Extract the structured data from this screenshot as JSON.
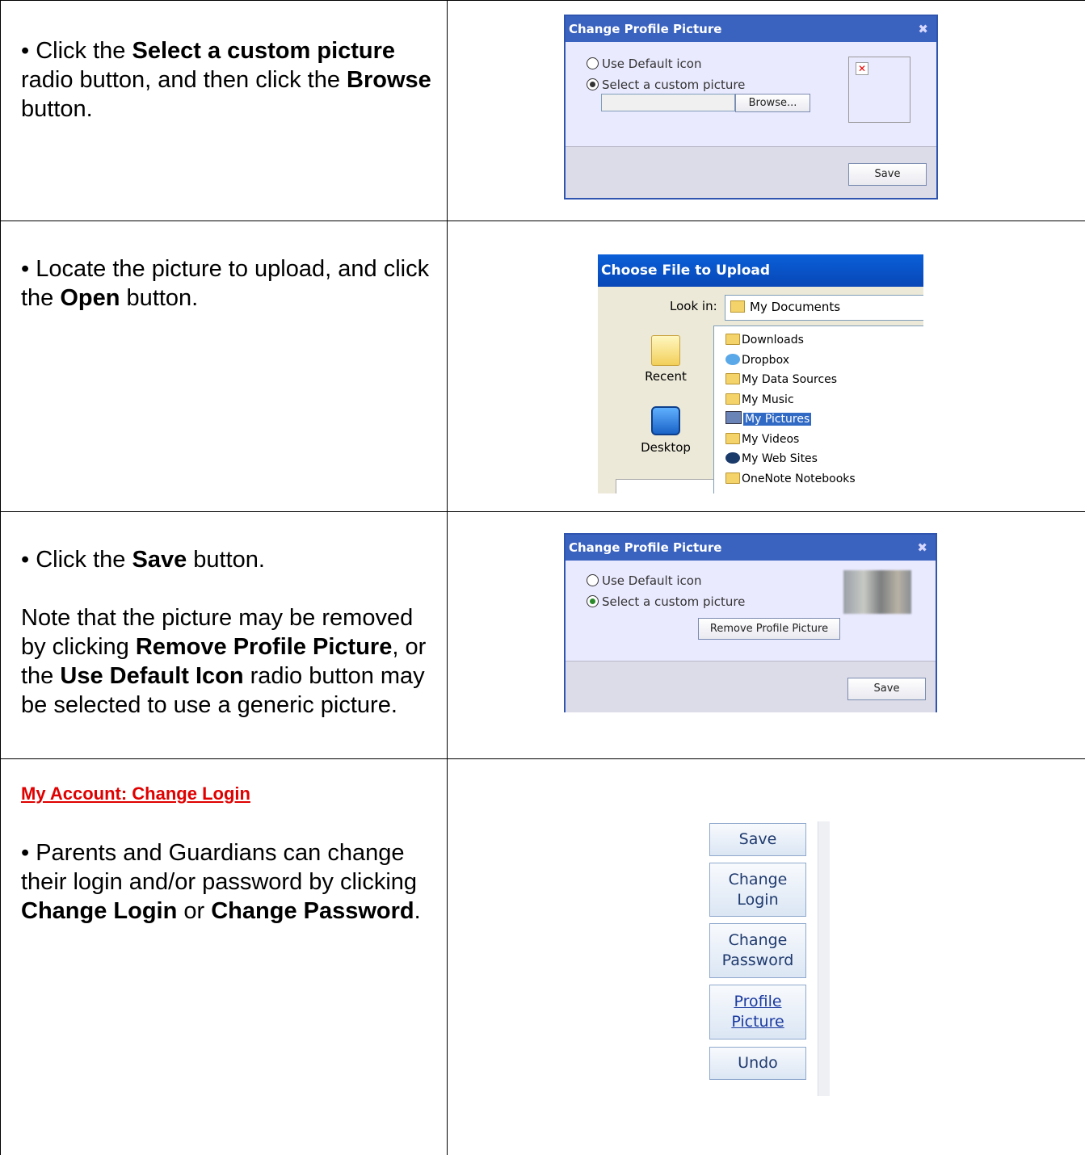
{
  "row1": {
    "bullet": "•",
    "t1": " Click the ",
    "b1": "Select a custom picture",
    "t2": " radio button, and then click the ",
    "b2": "Browse",
    "t3": " button."
  },
  "row2": {
    "bullet": "•",
    "t1": " Locate the picture to upload, and click the ",
    "b1": "Open",
    "t2": " button."
  },
  "row3": {
    "bullet": "•",
    "t1": " Click the ",
    "b1": "Save",
    "t2": " button.",
    "n1": "Note that the picture may be removed by clicking ",
    "nb1": "Remove Profile Picture",
    "n2": ", or the ",
    "nb2": "Use Default Icon",
    "n3": " radio button may be selected to use a generic picture."
  },
  "row4": {
    "section_title": "My Account: Change Login",
    "bullet": "•",
    "t1": " Parents and Guardians can change their login and/or password by clicking ",
    "b1": "Change Login",
    "t2": " or ",
    "b2": "Change Password",
    "t3": "."
  },
  "dialog1": {
    "title": "Change Profile Picture",
    "close_icon": "✖",
    "option_default": "Use Default icon",
    "option_custom": "Select a custom picture",
    "browse_label": "Browse...",
    "save_label": "Save",
    "broken_image_glyph": "✕"
  },
  "chooser": {
    "title": "Choose File to Upload",
    "look_in_label": "Look in:",
    "look_in_value": "My Documents",
    "places": [
      "Recent",
      "Desktop"
    ],
    "files": [
      "Downloads",
      "Dropbox",
      "My Data Sources",
      "My Music",
      "My Pictures",
      "My Videos",
      "My Web Sites",
      "OneNote Notebooks"
    ],
    "selected_file": "My Pictures"
  },
  "dialog2": {
    "title": "Change Profile Picture",
    "close_icon": "✖",
    "option_default": "Use Default icon",
    "option_custom": "Select a custom picture",
    "remove_label": "Remove Profile Picture",
    "save_label": "Save"
  },
  "account_buttons": {
    "save": "Save",
    "change_login_1": "Change",
    "change_login_2": "Login",
    "change_password_1": "Change",
    "change_password_2": "Password",
    "profile_picture_1": "Profile",
    "profile_picture_2": "Picture",
    "undo": "Undo"
  },
  "colors": {
    "section_title": "#e00000",
    "dialog_title_bar": "#3a62bf",
    "chooser_title_bar": "#0a5fd8",
    "selection": "#316ac5"
  }
}
